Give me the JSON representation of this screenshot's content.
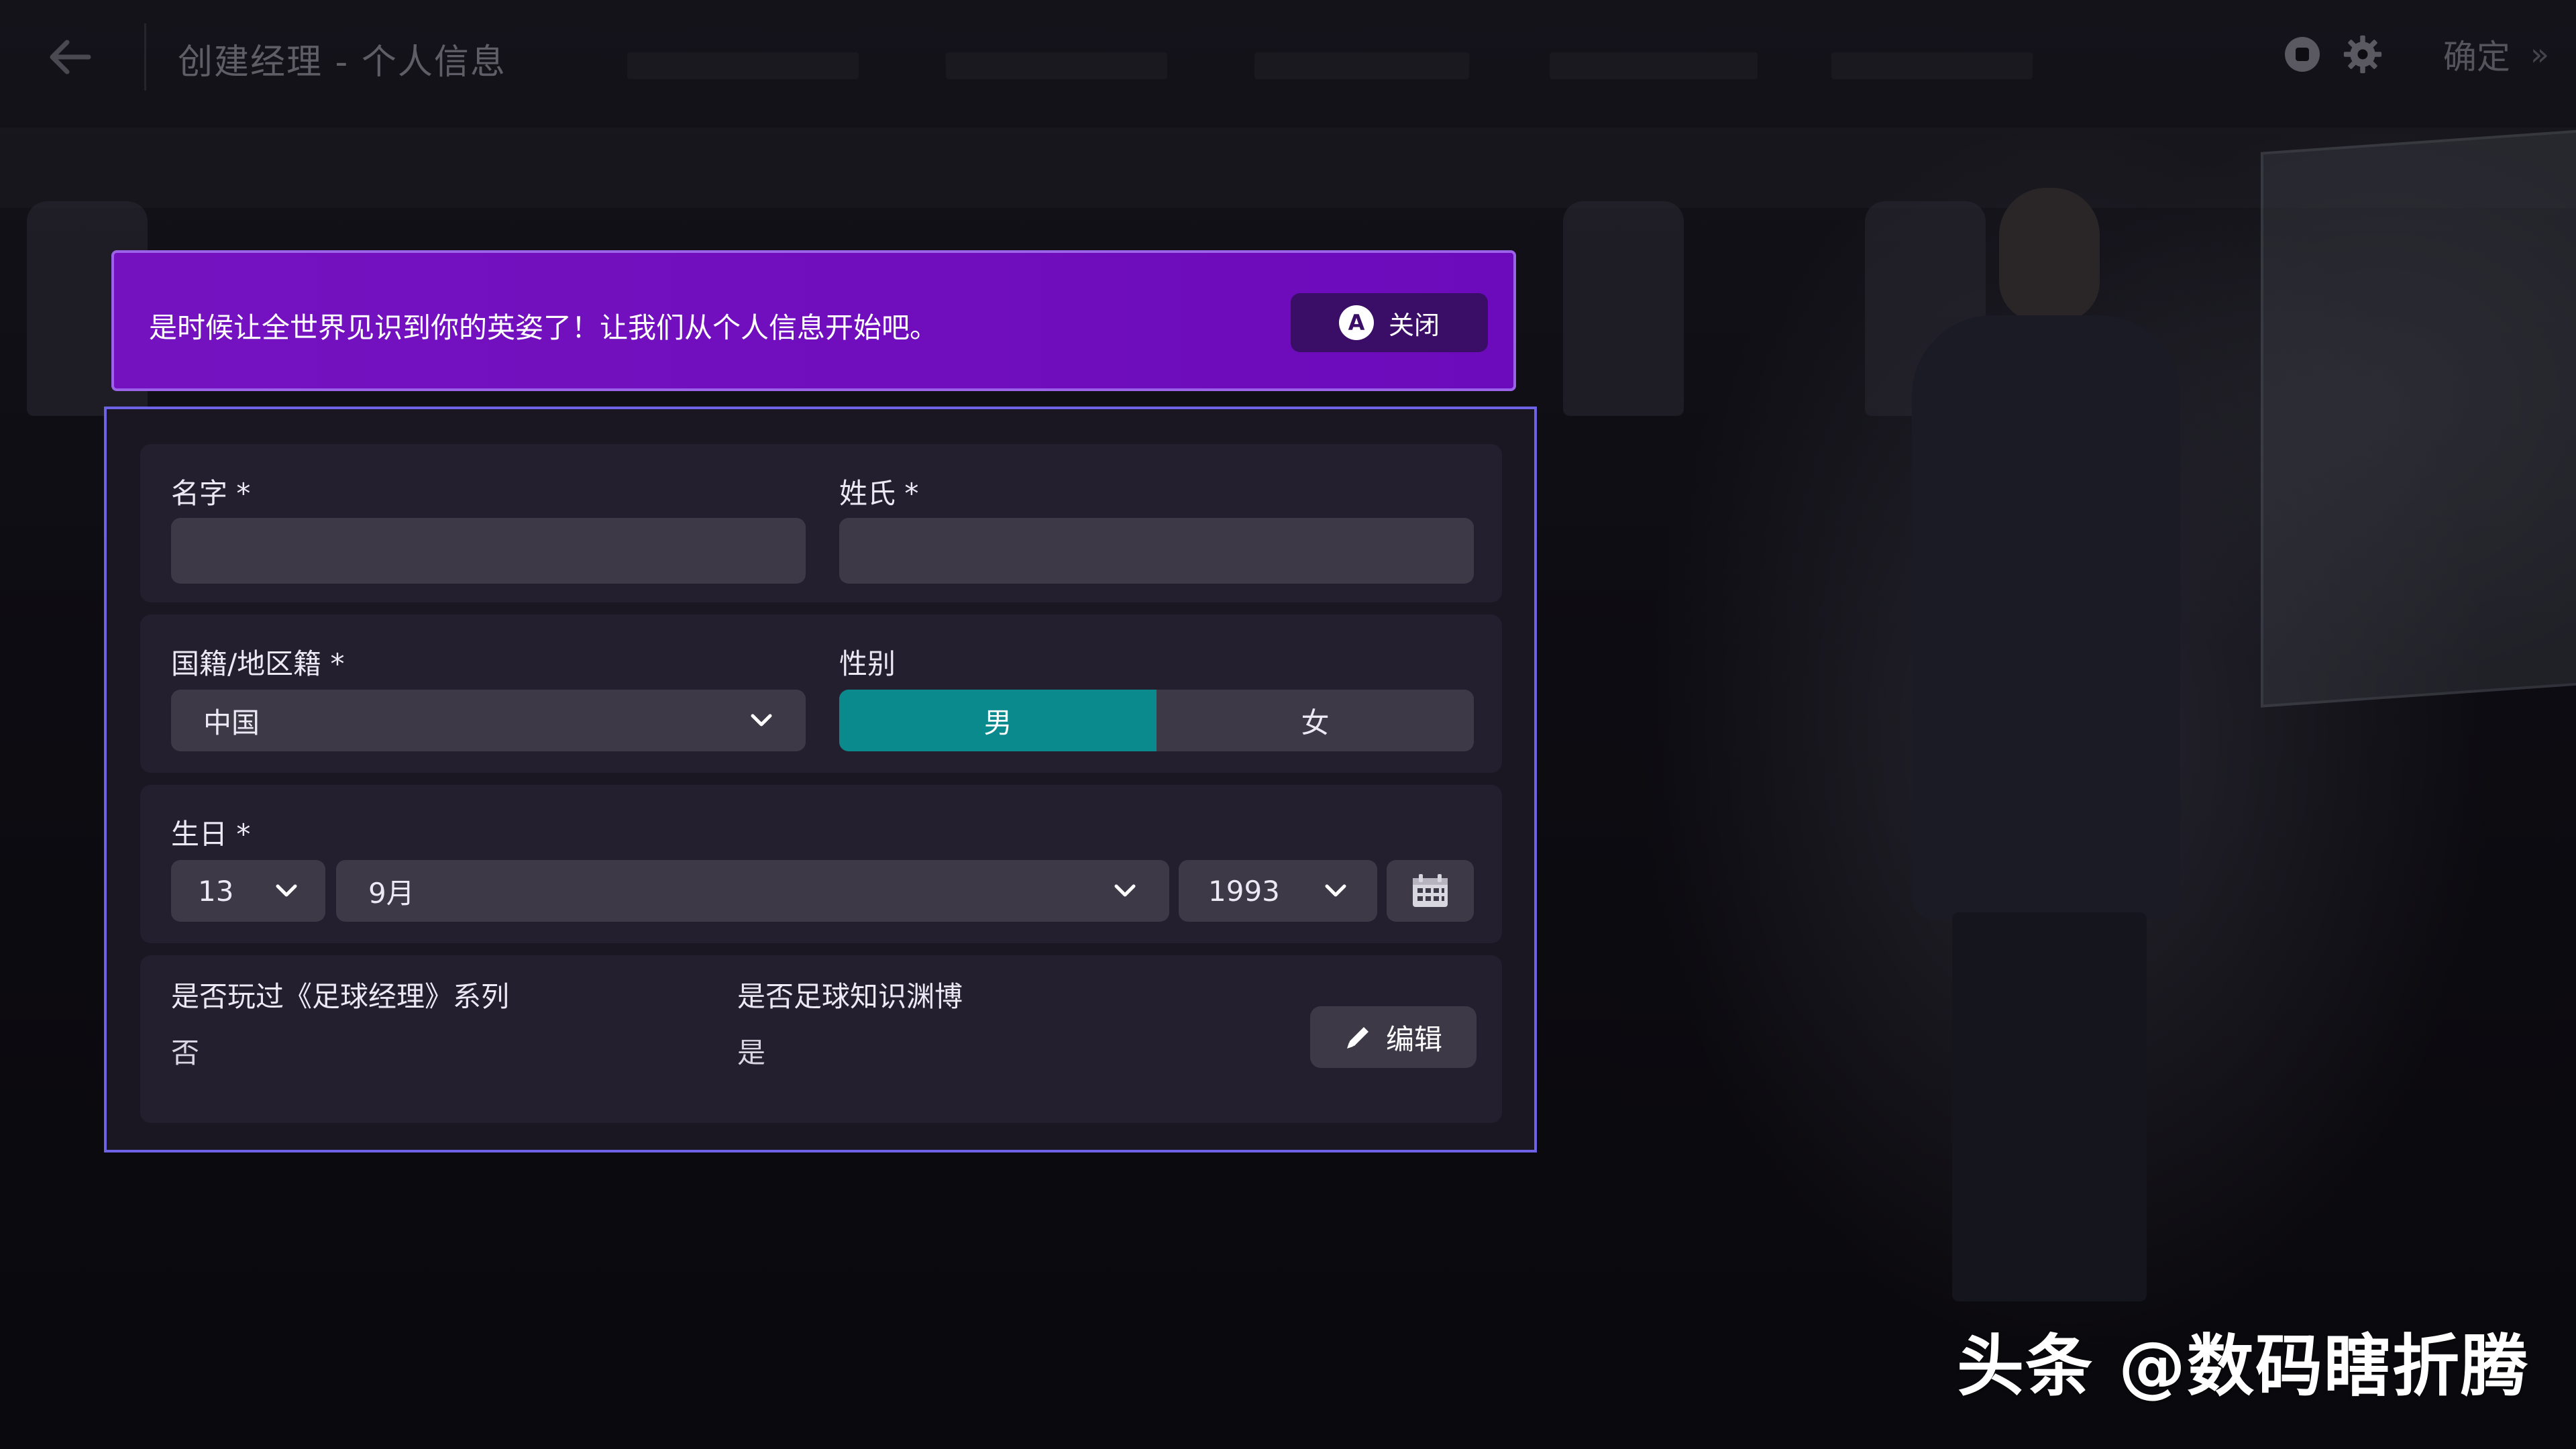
{
  "header": {
    "title": "创建经理 - 个人信息",
    "confirm_label": "确定"
  },
  "banner": {
    "message": "是时候让全世界见识到你的英姿了！让我们从个人信息开始吧。",
    "close_badge": "A",
    "close_label": "关闭"
  },
  "form": {
    "first_name": {
      "label": "名字 *",
      "value": ""
    },
    "last_name": {
      "label": "姓氏 *",
      "value": ""
    },
    "nationality": {
      "label": "国籍/地区籍 *",
      "value": "中国"
    },
    "gender": {
      "label": "性别",
      "options": [
        "男",
        "女"
      ],
      "selected": "男"
    },
    "birthday": {
      "label": "生日 *",
      "day": "13",
      "month": "9月",
      "year": "1993"
    },
    "played_series": {
      "label": "是否玩过《足球经理》系列",
      "value": "否"
    },
    "football_knowledge": {
      "label": "是否足球知识渊博",
      "value": "是"
    },
    "edit_label": "编辑"
  },
  "watermark": "头条 @数码瞎折腾",
  "colors": {
    "banner": "#7512c0",
    "panel_border": "#6e63e6",
    "gender_active": "#0b8a8e"
  }
}
